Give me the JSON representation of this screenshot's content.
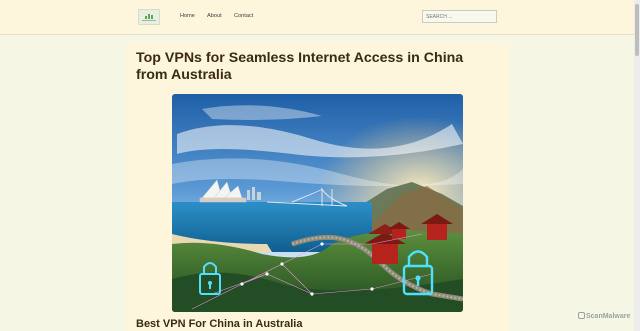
{
  "header": {
    "logo_icon": "bar-chart-logo-icon",
    "nav": [
      {
        "label": "Home"
      },
      {
        "label": "About"
      },
      {
        "label": "Contact"
      }
    ],
    "search": {
      "placeholder": "SEARCH ..."
    }
  },
  "article": {
    "title": "Top VPNs for Seamless Internet Access in China from Australia",
    "hero_image": {
      "subject": "Sydney Opera House, Great Wall of China and padlock icons"
    },
    "subtitle": "Best VPN For China in Australia"
  },
  "watermark": {
    "text": "ScanMalware"
  },
  "colors": {
    "page_bg": "#f5f7e4",
    "header_bg": "#fdf6dc",
    "content_bg": "#fdf6dc",
    "title_text": "#3b2b14"
  }
}
